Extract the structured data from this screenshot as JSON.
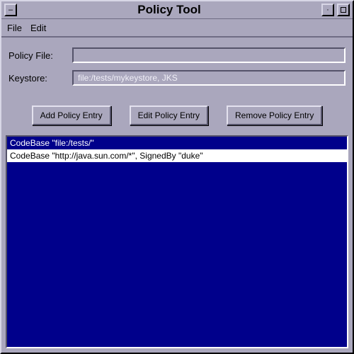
{
  "window": {
    "title": "Policy Tool"
  },
  "menubar": {
    "file": "File",
    "edit": "Edit"
  },
  "form": {
    "policy_file_label": "Policy File:",
    "policy_file_value": "",
    "keystore_label": "Keystore:",
    "keystore_value": "file:/tests/mykeystore, JKS"
  },
  "buttons": {
    "add": "Add Policy Entry",
    "edit": "Edit Policy Entry",
    "remove": "Remove Policy Entry"
  },
  "list": {
    "items": [
      "CodeBase \"file:/tests/\"",
      "CodeBase \"http://java.sun.com/*\", SignedBy \"duke\""
    ],
    "selected_index": 1
  }
}
